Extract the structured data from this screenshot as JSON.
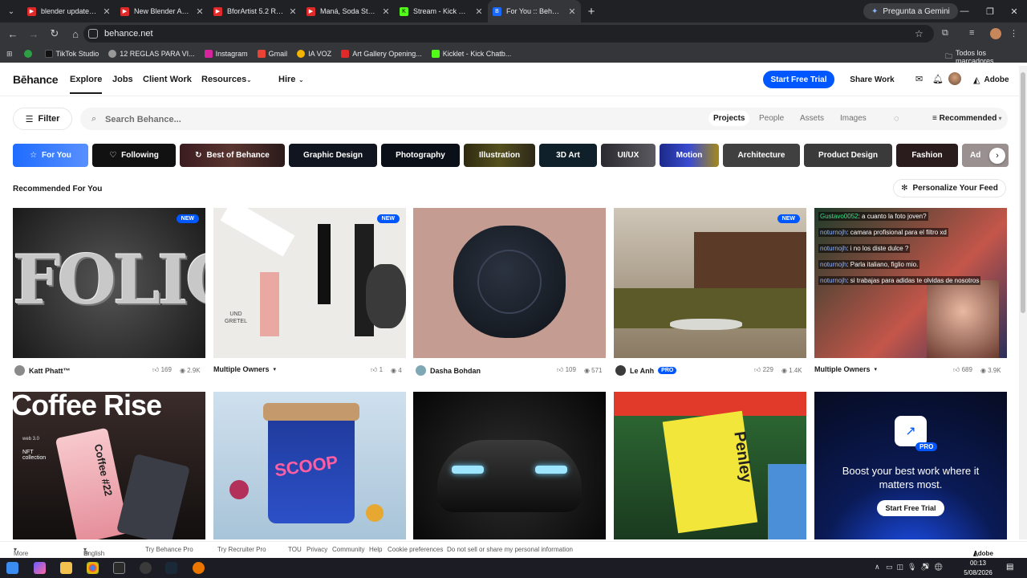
{
  "browser": {
    "tabs": [
      {
        "title": "blender update - Yo",
        "color": "#e02a2a",
        "active": false
      },
      {
        "title": "New Blender Addon",
        "color": "#e02a2a",
        "active": false
      },
      {
        "title": "BforArtist 5.2 Relea",
        "color": "#e02a2a",
        "active": false
      },
      {
        "title": "Maná, Soda Stereo,",
        "color": "#e02a2a",
        "active": false
      },
      {
        "title": "Stream - Kick Dashb",
        "color": "#53fc18",
        "active": false
      },
      {
        "title": "For You :: Behance",
        "color": "#1769ff",
        "active": true
      }
    ],
    "gemini": "Pregunta a Gemini",
    "url": "behance.net",
    "bookmarks": [
      {
        "label": "",
        "color": "#2ea043"
      },
      {
        "label": "TikTok Studio",
        "color": "#111"
      },
      {
        "label": "12 REGLAS PARA VI...",
        "color": "#999"
      },
      {
        "label": "Instagram",
        "color": "#d6249f"
      },
      {
        "label": "Gmail",
        "color": "#ea4335"
      },
      {
        "label": "IA VOZ",
        "color": "#f4b400"
      },
      {
        "label": "Art Gallery Opening...",
        "color": "#e02a2a"
      },
      {
        "label": "Kicklet - Kick Chatb...",
        "color": "#53fc18"
      }
    ],
    "all_bookmarks": "Todos los marcadores"
  },
  "header": {
    "logo": "Bēhance",
    "nav": [
      "Explore",
      "Jobs",
      "Client Work",
      "Resources",
      "Hire"
    ],
    "start_trial": "Start Free Trial",
    "share": "Share Work",
    "adobe": "Adobe"
  },
  "search": {
    "filter": "Filter",
    "placeholder": "Search Behance...",
    "tabs": [
      "Projects",
      "People",
      "Assets",
      "Images"
    ],
    "sort": "Recommended"
  },
  "categories": [
    "For You",
    "Following",
    "Best of Behance",
    "Graphic Design",
    "Photography",
    "Illustration",
    "3D Art",
    "UI/UX",
    "Motion",
    "Architecture",
    "Product Design",
    "Fashion",
    "Ad"
  ],
  "section": {
    "title": "Recommended For You",
    "personalize": "Personalize Your Feed"
  },
  "cards_row1": [
    {
      "owner": "Katt Phatt™",
      "likes": "169",
      "views": "2.9K",
      "badge": "NEW"
    },
    {
      "owner": "Multiple Owners",
      "likes": "1",
      "views": "4",
      "badge": "NEW"
    },
    {
      "owner": "Dasha Bohdan",
      "likes": "109",
      "views": "571",
      "badge": ""
    },
    {
      "owner": "Le Anh",
      "likes": "229",
      "views": "1.4K",
      "badge": "NEW",
      "pro": "PRO"
    },
    {
      "owner": "Multiple Owners",
      "likes": "689",
      "views": "3.9K",
      "badge": ""
    }
  ],
  "card_texts": {
    "folio": "FOLIO",
    "coffee": "Coffee Rise",
    "coffee_cup": "Coffee #22",
    "coffee_small": "web 3.0",
    "nft": "NFT collection",
    "scoop": "SCOOP",
    "penley": "Penley",
    "und_gretel": "UND GRETEL"
  },
  "chat": [
    {
      "user": "Gustavo0052",
      "msg": ": a cuanto la foto joven?"
    },
    {
      "user": "noturnojh",
      "msg": ": camara profisional para el filtro xd"
    },
    {
      "user": "noturnojh",
      "msg": ": i no los diste dulce ?"
    },
    {
      "user": "noturnojh",
      "msg": ": Parla italiano, figlio mio."
    },
    {
      "user": "noturnojh",
      "msg": ": si trabajas para adidas te olvidas de nosotros"
    }
  ],
  "promo": {
    "badge": "PRO",
    "headline": "Boost your best work where it matters most.",
    "cta": "Start Free Trial"
  },
  "footer": [
    "More Behance",
    "English",
    "Try Behance Pro",
    "Try Recruiter Pro",
    "TOU",
    "Privacy",
    "Community",
    "Help",
    "Cookie preferences",
    "Do not sell or share my personal information"
  ],
  "footer_adobe": "Adobe",
  "taskbar": {
    "time": "00:13",
    "date": "5/08/2026"
  }
}
